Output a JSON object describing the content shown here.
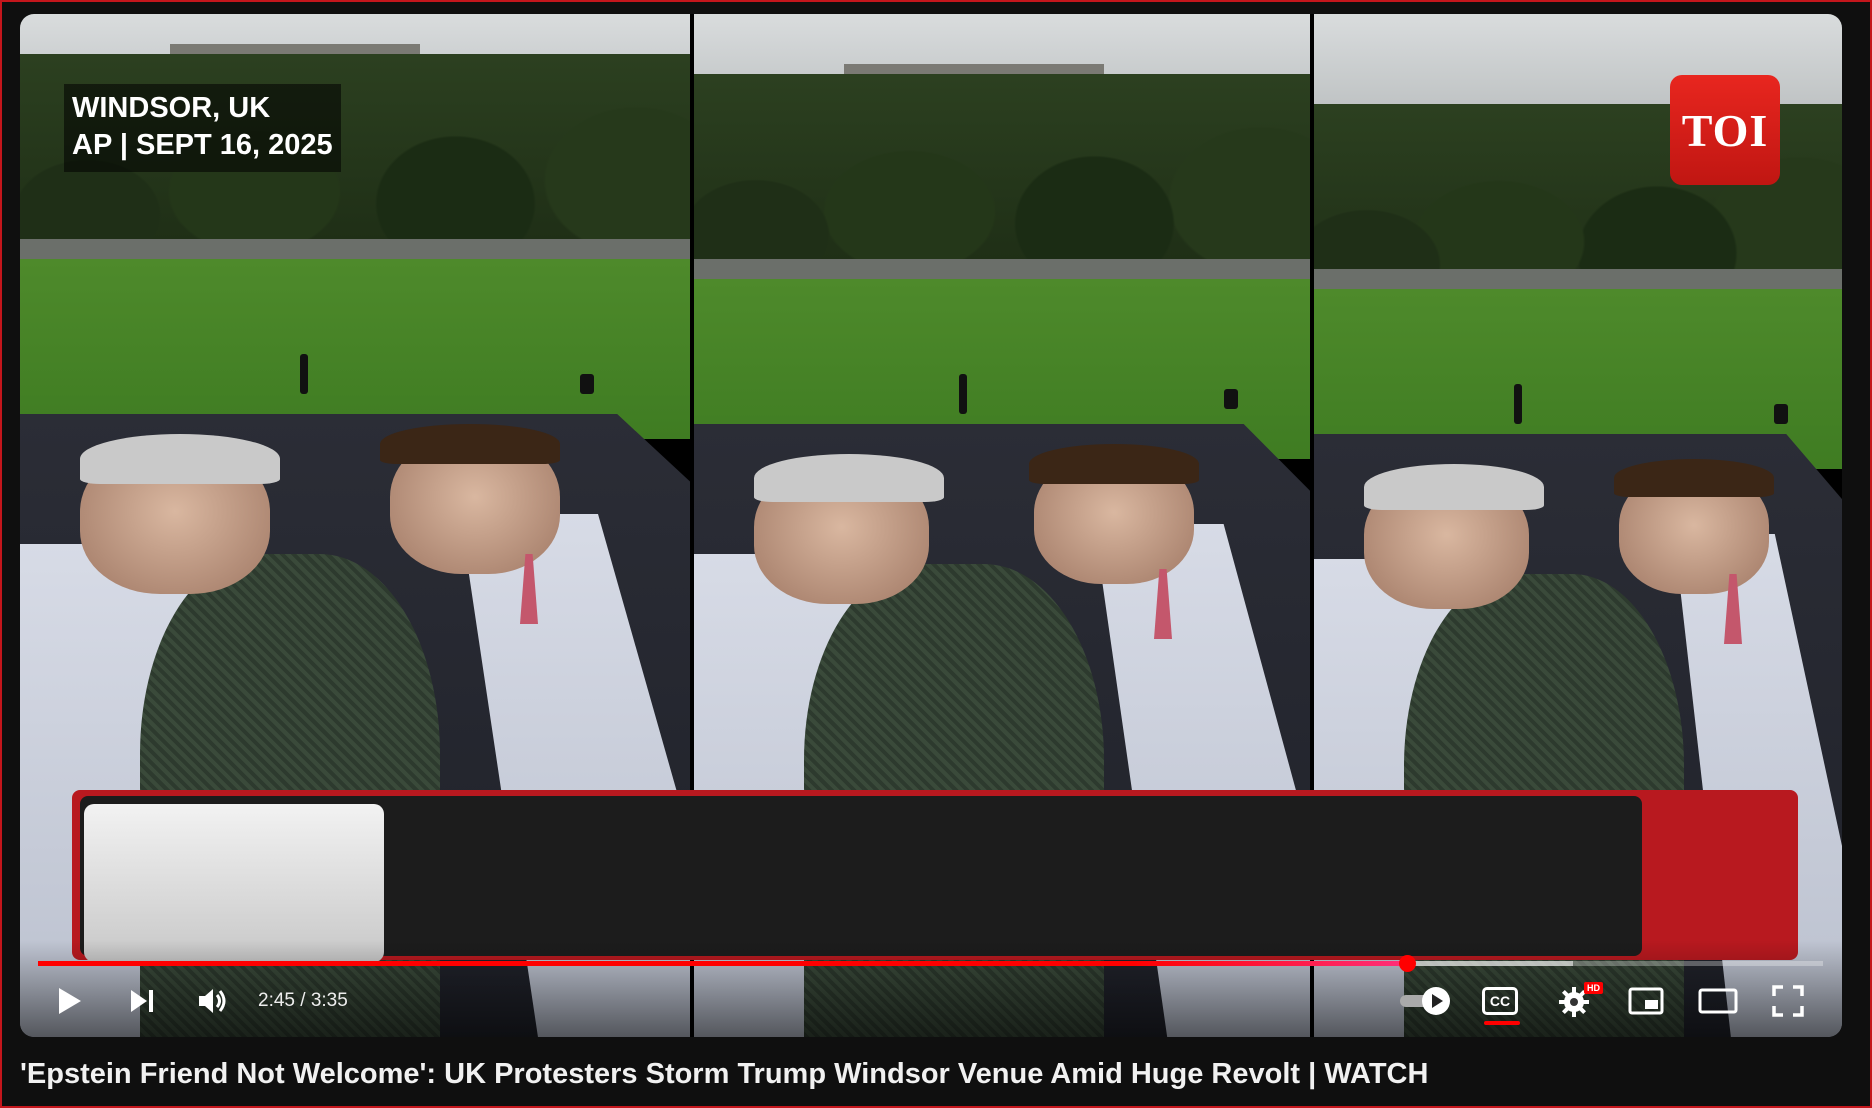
{
  "video": {
    "overlay": {
      "location_line1": "WINDSOR, UK",
      "location_line2": "AP | SEPT 16, 2025",
      "logo_text": "TOI"
    },
    "controls": {
      "play_icon": "play-icon",
      "next_icon": "skip-next-icon",
      "volume_icon": "volume-icon",
      "current_time": "2:45",
      "duration": "3:35",
      "time_display": "2:45 / 3:35",
      "autoplay_icon": "autoplay-toggle-icon",
      "cc_label": "CC",
      "settings_icon": "gear-icon",
      "hd_badge": "HD",
      "miniplayer_icon": "miniplayer-icon",
      "theater_icon": "theater-mode-icon",
      "fullscreen_icon": "fullscreen-icon"
    },
    "progress": {
      "played_fraction": 0.767,
      "buffered_fraction": 0.86
    },
    "colors": {
      "accent": "#ff0000",
      "overlay_red": "#b8191f",
      "logo_red": "#e8261f"
    }
  },
  "title": "'Epstein Friend Not Welcome': UK Protesters Storm Trump Windsor Venue Amid Huge Revolt | WATCH"
}
